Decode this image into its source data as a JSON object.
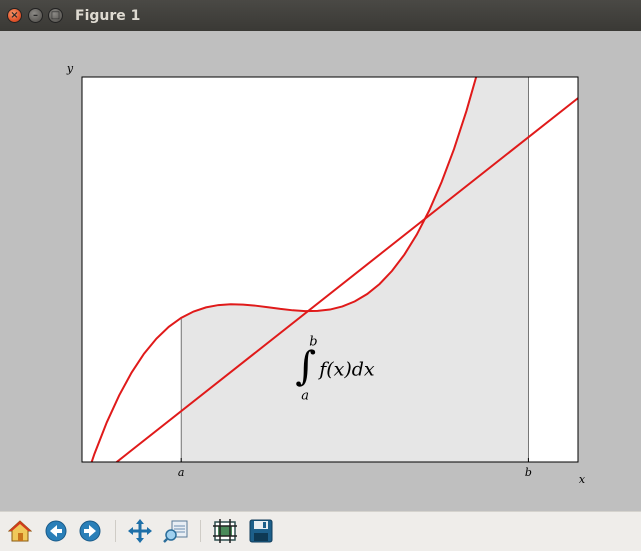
{
  "window": {
    "title": "Figure 1"
  },
  "toolbar": {
    "items": [
      {
        "name": "home-icon"
      },
      {
        "name": "back-arrow-icon"
      },
      {
        "name": "forward-arrow-icon"
      },
      {
        "name": "pan-move-icon"
      },
      {
        "name": "zoom-rectangle-icon"
      },
      {
        "name": "configure-subplots-icon"
      },
      {
        "name": "save-floppy-icon"
      }
    ]
  },
  "chart_data": {
    "type": "line",
    "xlabel": "x",
    "ylabel": "y",
    "xlim": [
      0,
      10
    ],
    "ylim": [
      0,
      250
    ],
    "xticks": [
      {
        "value": 2,
        "label": "a"
      },
      {
        "value": 9,
        "label": "b"
      }
    ],
    "integral_limits": [
      2,
      9
    ],
    "annotation": {
      "text": "f(x)dx",
      "lower": "a",
      "upper": "b",
      "x": 4.5,
      "y": 60
    },
    "colors": {
      "line": "#e01a1a",
      "fill": "#e6e6e6",
      "axes_bg": "#ffffff",
      "figure_bg": "#bfbfbf"
    },
    "series": [
      {
        "x": [
          0,
          0.25,
          0.5,
          0.75,
          1,
          1.25,
          1.5,
          1.75,
          2,
          2.25,
          2.5,
          2.75,
          3,
          3.25,
          3.5,
          3.75,
          4,
          4.25,
          4.5,
          4.75,
          5,
          5.25,
          5.5,
          5.75,
          6,
          6.25,
          6.5,
          6.75,
          7,
          7.25,
          7.5,
          7.75,
          8,
          8.25,
          8.5,
          8.75,
          9,
          9.25,
          9.5,
          9.75,
          10
        ],
        "y": [
          -18.6,
          5.2,
          25.8,
          43.3,
          58.1,
          70.3,
          80.1,
          87.8,
          93.6,
          97.7,
          100.4,
          101.9,
          102.4,
          102.2,
          101.5,
          100.5,
          99.4,
          98.5,
          98.0,
          98.1,
          99.0,
          101.0,
          104.3,
          109.1,
          115.6,
          124.1,
          134.7,
          147.7,
          163.3,
          181.8,
          203.2,
          227.9,
          256.0,
          287.8,
          323.4,
          363.2,
          407.2,
          455.8,
          509.1,
          567.4,
          631.0
        ]
      },
      {
        "x": [
          0,
          10
        ],
        "y": [
          -17.8,
          236.3
        ]
      }
    ]
  }
}
